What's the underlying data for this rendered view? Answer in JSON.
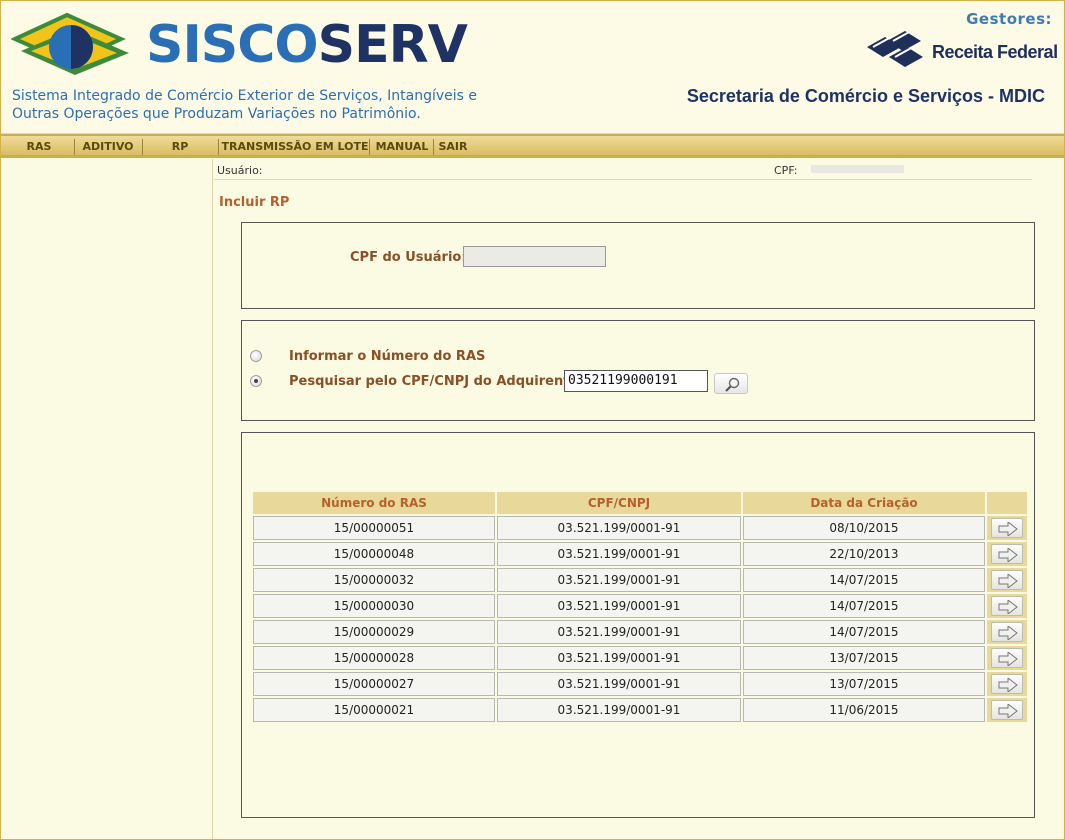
{
  "header": {
    "brand_part1": "SISCO",
    "brand_part2": "SERV",
    "tagline_line1": "Sistema Integrado de Comércio Exterior de Serviços, Intangíveis e",
    "tagline_line2": "Outras Operações que Produzam Variações no Patrimônio.",
    "gestores": "Gestores:",
    "receita_federal": "Receita Federal",
    "secretaria": "Secretaria de Comércio e Serviços - MDIC"
  },
  "menu": [
    "RAS",
    "ADITIVO",
    "RP",
    "TRANSMISSÃO EM LOTE",
    "MANUAL",
    "SAIR"
  ],
  "userbar": {
    "usuario_label": "Usuário:",
    "cpf_label": "CPF:"
  },
  "page_title": "Incluir RP",
  "cpf_form": {
    "label": "CPF do Usuário:",
    "value": ""
  },
  "search": {
    "option1": "Informar o Número do RAS",
    "option2": "Pesquisar pelo CPF/CNPJ do Adquirente",
    "selected": "option2",
    "value": "03521199000191"
  },
  "table": {
    "headers": [
      "Número do RAS",
      "CPF/CNPJ",
      "Data da Criação",
      ""
    ],
    "rows": [
      [
        "15/00000051",
        "03.521.199/0001-91",
        "08/10/2015"
      ],
      [
        "15/00000048",
        "03.521.199/0001-91",
        "22/10/2013"
      ],
      [
        "15/00000032",
        "03.521.199/0001-91",
        "14/07/2015"
      ],
      [
        "15/00000030",
        "03.521.199/0001-91",
        "14/07/2015"
      ],
      [
        "15/00000029",
        "03.521.199/0001-91",
        "14/07/2015"
      ],
      [
        "15/00000028",
        "03.521.199/0001-91",
        "13/07/2015"
      ],
      [
        "15/00000027",
        "03.521.199/0001-91",
        "13/07/2015"
      ],
      [
        "15/00000021",
        "03.521.199/0001-91",
        "11/06/2015"
      ]
    ],
    "row_action_icon": "arrow-right-icon"
  },
  "colors": {
    "brand_light": "#2a6fb5",
    "brand_dark": "#1e3264",
    "title_accent": "#b5602e",
    "menu_gold": "#d9bd62",
    "page_bg": "#fbfbe3"
  }
}
